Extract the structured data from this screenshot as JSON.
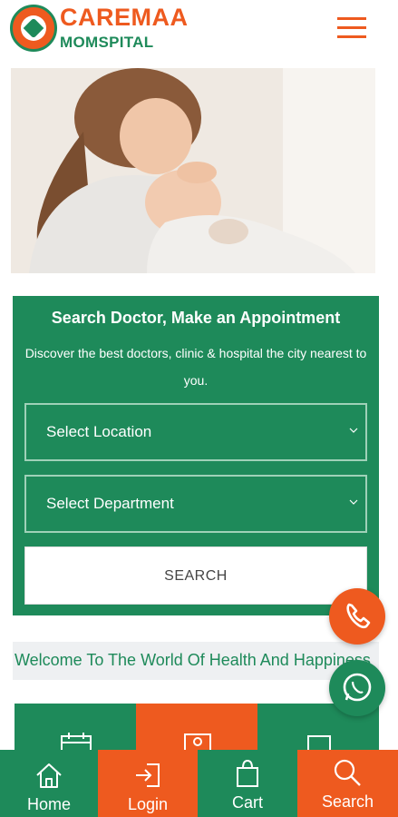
{
  "header": {
    "brand_top": "CAREMAA",
    "brand_bottom": "MOMSPITAL",
    "menu_icon": "hamburger-menu-icon"
  },
  "hero": {
    "image": "mother-holding-sleeping-baby"
  },
  "search_panel": {
    "title": "Search Doctor, Make an Appointment",
    "description": "Discover the best doctors, clinic & hospital the city nearest to you.",
    "location_select": "Select Location",
    "department_select": "Select Department",
    "search_button": "SEARCH"
  },
  "welcome": {
    "text": "Welcome To The World Of Health And Happiness"
  },
  "floating": {
    "call_icon": "phone-icon",
    "whatsapp_icon": "whatsapp-icon"
  },
  "bottom_nav": {
    "items": [
      {
        "label": "Home",
        "icon": "home-icon"
      },
      {
        "label": "Login",
        "icon": "login-icon"
      },
      {
        "label": "Cart",
        "icon": "cart-icon"
      },
      {
        "label": "Search",
        "icon": "search-icon"
      }
    ]
  },
  "colors": {
    "brand_orange": "#ee5a1f",
    "brand_green": "#1e8a5a",
    "white": "#ffffff"
  }
}
